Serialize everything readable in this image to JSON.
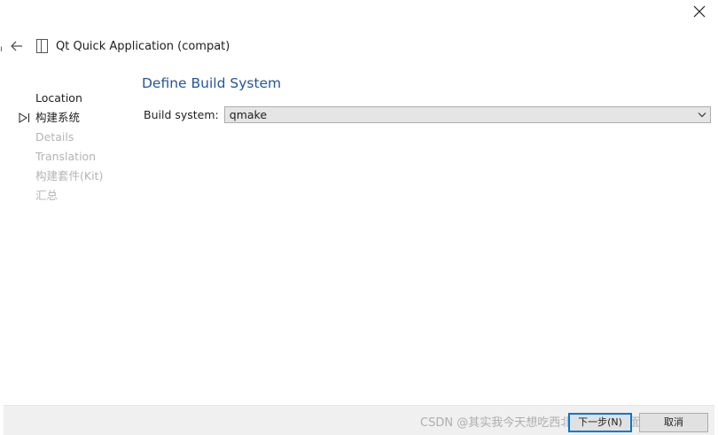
{
  "window": {
    "title": "Qt Quick Application (compat)",
    "edge_mark": "ı"
  },
  "steps": [
    {
      "label": "Location",
      "state": "done"
    },
    {
      "label": "构建系统",
      "state": "active"
    },
    {
      "label": "Details",
      "state": "pending"
    },
    {
      "label": "Translation",
      "state": "pending"
    },
    {
      "label": "构建套件(Kit)",
      "state": "pending"
    },
    {
      "label": "汇总",
      "state": "pending"
    }
  ],
  "page": {
    "heading": "Define Build System",
    "build_system_label": "Build system:",
    "build_system_value": "qmake"
  },
  "footer": {
    "next_label": "下一步(N)",
    "cancel_label": "取消",
    "watermark": "CSDN @其实我今天想吃西北黄焖羊肉板面"
  },
  "icons": {
    "close": "close-icon",
    "back": "back-arrow-icon",
    "page": "document-icon",
    "current_step": "current-step-arrow-icon",
    "dropdown": "chevron-down-icon"
  },
  "colors": {
    "heading": "#23579c",
    "pending_step": "#b4b4b4",
    "default_button_border": "#0078d7",
    "footer_bg": "#f0f0f0",
    "combo_bg": "#e5e5e5"
  }
}
